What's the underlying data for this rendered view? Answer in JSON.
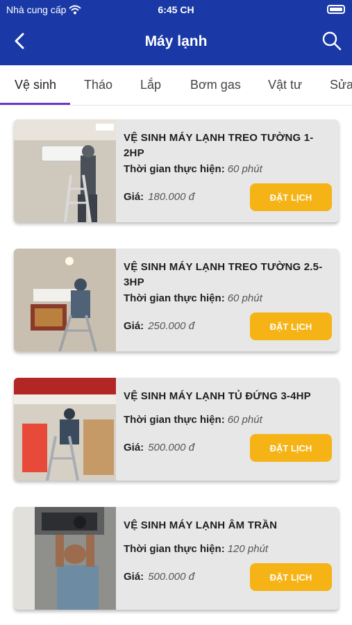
{
  "status_bar": {
    "carrier": "Nhà cung cấp",
    "time": "6:45 CH"
  },
  "header": {
    "title": "Máy lạnh"
  },
  "tabs": [
    "Vệ sinh",
    "Tháo",
    "Lắp",
    "Bơm gas",
    "Vật tư",
    "Sửa"
  ],
  "services": [
    {
      "name": "VỆ SINH MÁY LẠNH TREO TƯỜNG 1-2HP",
      "time_label": "Thời gian thực hiện:",
      "time_value": "60 phút",
      "price_label": "Giá:",
      "price_value": "180.000 đ",
      "button": "ĐẶT LỊCH"
    },
    {
      "name": "VỆ SINH MÁY LẠNH TREO TƯỜNG 2.5-3HP",
      "time_label": "Thời gian thực hiện:",
      "time_value": "60 phút",
      "price_label": "Giá:",
      "price_value": "250.000 đ",
      "button": "ĐẶT LỊCH"
    },
    {
      "name": "VỆ SINH MÁY LẠNH TỦ ĐỨNG 3-4HP",
      "time_label": "Thời gian thực hiện:",
      "time_value": "60 phút",
      "price_label": "Giá:",
      "price_value": "500.000 đ",
      "button": "ĐẶT LỊCH"
    },
    {
      "name": "VỆ SINH MÁY LẠNH ÂM TRẦN",
      "time_label": "Thời gian thực hiện:",
      "time_value": "120 phút",
      "price_label": "Giá:",
      "price_value": "500.000 đ",
      "button": "ĐẶT LỊCH"
    }
  ],
  "icons": {
    "wifi": "wifi-icon",
    "battery": "battery-icon",
    "back": "chevron-left-icon",
    "search": "search-icon"
  },
  "colors": {
    "header_bg": "#1a39a6",
    "tab_indicator": "#6a39c9",
    "button_bg": "#f5b315",
    "card_bg": "#e7e7e7"
  }
}
